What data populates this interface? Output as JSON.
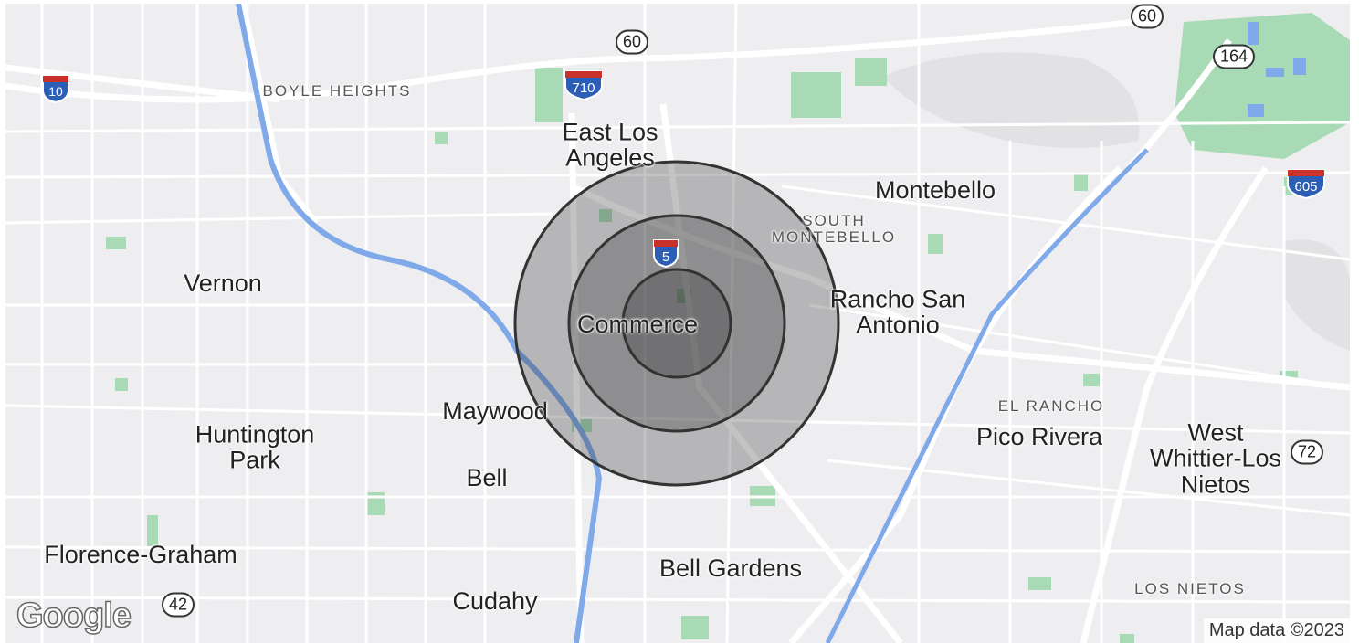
{
  "map": {
    "places": {
      "east_los_angeles": "East Los\nAngeles",
      "montebello": "Montebello",
      "vernon": "Vernon",
      "commerce": "Commerce",
      "rancho_san_antonio": "Rancho San\nAntonio",
      "maywood": "Maywood",
      "huntington_park": "Huntington\nPark",
      "bell": "Bell",
      "pico_rivera": "Pico Rivera",
      "west_whittier": "West\nWhittier-Los\nNietos",
      "florence_graham": "Florence-Graham",
      "bell_gardens": "Bell Gardens",
      "cudahy": "Cudahy"
    },
    "neighborhoods": {
      "boyle_heights": "BOYLE HEIGHTS",
      "south_montebello": "SOUTH\nMONTEBELLO",
      "el_rancho": "EL RANCHO",
      "los_nietos": "LOS NIETOS"
    },
    "shields": {
      "i10": "10",
      "i710": "710",
      "i5": "5",
      "i605": "605",
      "sr60_a": "60",
      "sr60_b": "60",
      "sr164": "164",
      "sr72": "72",
      "sr42": "42"
    },
    "logo": "Google",
    "attribution": "Map data ©2023",
    "colors": {
      "base": "#eeeef1",
      "park": "#a8dab5",
      "river": "#7fa9e8",
      "ring": "#333333"
    }
  }
}
